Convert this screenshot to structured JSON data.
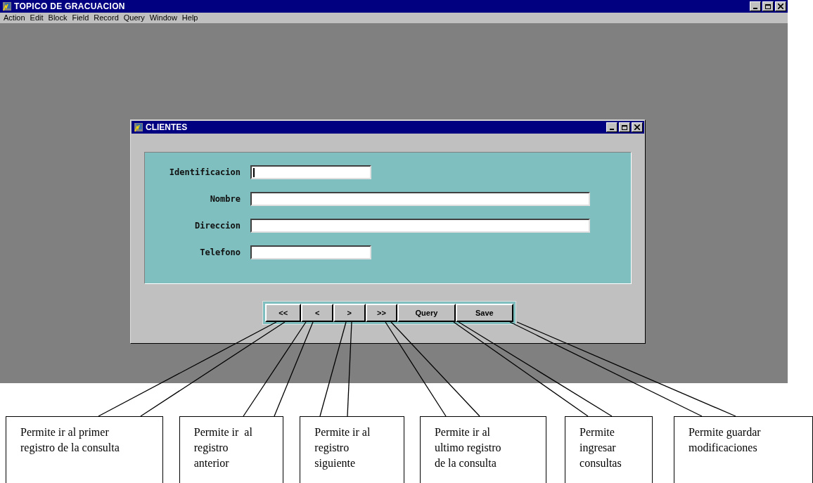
{
  "window": {
    "title": "TOPICO DE GRACUACION"
  },
  "menu": [
    "Action",
    "Edit",
    "Block",
    "Field",
    "Record",
    "Query",
    "Window",
    "Help"
  ],
  "form": {
    "title": "CLIENTES",
    "fields": [
      {
        "label": "Identificacion",
        "kind": "short",
        "focused": true
      },
      {
        "label": "Nombre",
        "kind": "long",
        "focused": false
      },
      {
        "label": "Direccion",
        "kind": "long",
        "focused": false
      },
      {
        "label": "Telefono",
        "kind": "short",
        "focused": false
      }
    ],
    "buttons": [
      "<<",
      "<",
      ">",
      ">>",
      "Query",
      "Save"
    ]
  },
  "callouts": [
    "Permite ir al primer\nregistro de la consulta",
    "Permite ir  al\nregistro\nanterior",
    "Permite ir al\nregistro\nsiguiente",
    "Permite ir al\nultimo registro\nde la consulta",
    "Permite\ningresar\nconsultas",
    "Permite guardar\nmodificaciones"
  ]
}
